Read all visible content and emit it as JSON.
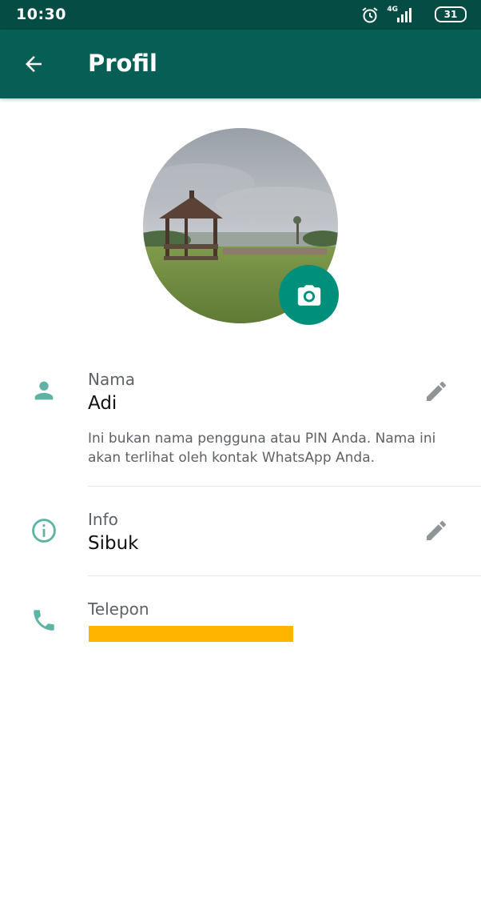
{
  "status_bar": {
    "time": "10:30",
    "network": "4G",
    "battery": "31",
    "icons": [
      "alarm-icon",
      "signal-icon",
      "battery-icon"
    ]
  },
  "app_bar": {
    "title": "Profil",
    "back_icon": "arrow-left-icon",
    "background": "#075e54"
  },
  "profile": {
    "photo_action_icon": "camera-icon",
    "accent": "#008f7a"
  },
  "fields": {
    "name": {
      "label": "Nama",
      "value": "Adi",
      "hint": "Ini bukan nama pengguna atau PIN Anda. Nama ini akan terlihat oleh kontak WhatsApp Anda.",
      "icon": "person-icon"
    },
    "about": {
      "label": "Info",
      "value": "Sibuk",
      "icon": "info-icon"
    },
    "phone": {
      "label": "Telepon",
      "icon": "phone-icon",
      "redaction_color": "#ffb400"
    }
  }
}
